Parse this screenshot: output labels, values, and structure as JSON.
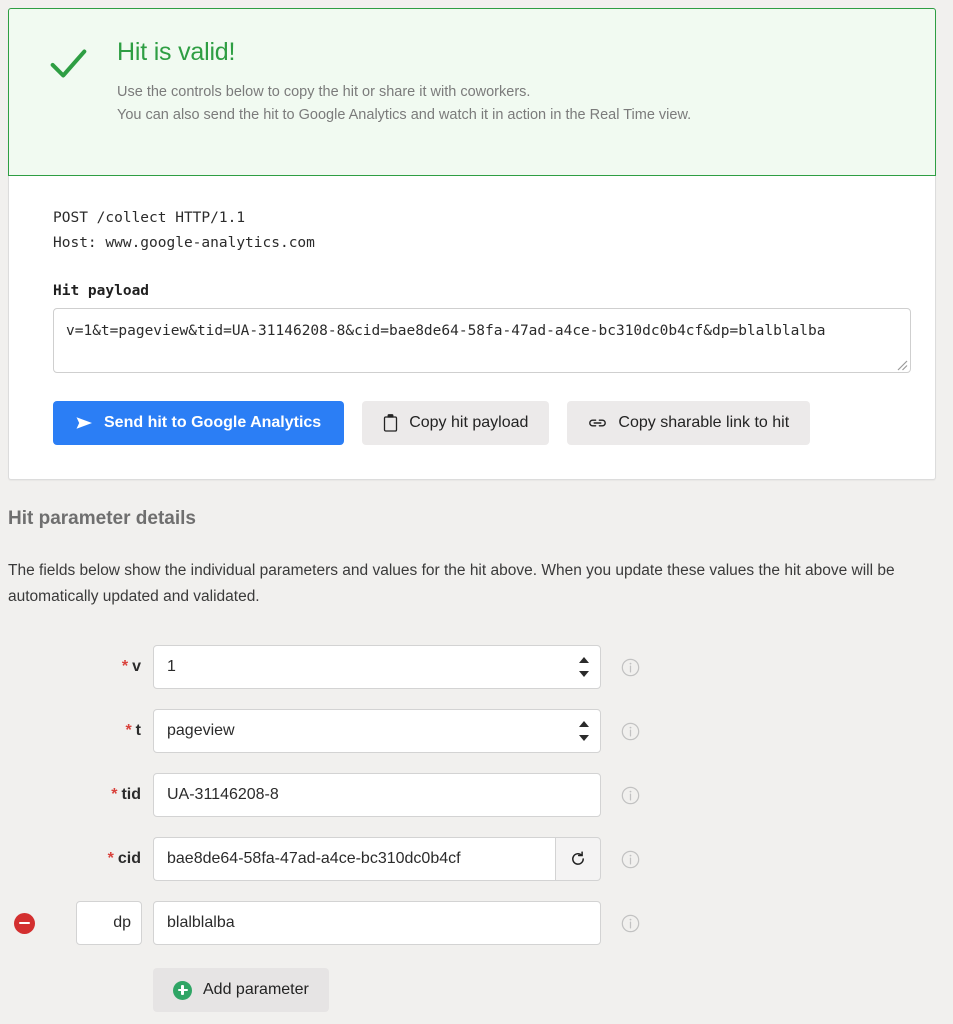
{
  "banner": {
    "icon": "check-icon",
    "title": "Hit is valid!",
    "line1": "Use the controls below to copy the hit or share it with coworkers.",
    "line2": "You can also send the hit to Google Analytics and watch it in action in the Real Time view.",
    "accent_color": "#2e9e43",
    "background_color": "#f1faf1"
  },
  "request": {
    "line1": "POST /collect HTTP/1.1",
    "line2": "Host: www.google-analytics.com",
    "payload_label": "Hit payload",
    "payload_value": "v=1&t=pageview&tid=UA-31146208-8&cid=bae8de64-58fa-47ad-a4ce-bc310dc0b4cf&dp=blalblalba"
  },
  "actions": {
    "send": {
      "label": "Send hit to Google Analytics",
      "icon": "send-icon",
      "color": "#2b7ef5"
    },
    "copy_payload": {
      "label": "Copy hit payload",
      "icon": "clipboard-icon"
    },
    "copy_link": {
      "label": "Copy sharable link to hit",
      "icon": "link-icon"
    }
  },
  "details": {
    "title": "Hit parameter details",
    "description": "The fields below show the individual parameters and values for the hit above. When you update these values the hit above will be automatically updated and validated."
  },
  "form": {
    "required_marker": "*",
    "rows": [
      {
        "name": "v",
        "label": "v",
        "required": true,
        "control": "select",
        "value": "1",
        "info": "info-icon"
      },
      {
        "name": "t",
        "label": "t",
        "required": true,
        "control": "select",
        "value": "pageview",
        "info": "info-icon"
      },
      {
        "name": "tid",
        "label": "tid",
        "required": true,
        "control": "text",
        "value": "UA-31146208-8",
        "info": "info-icon"
      },
      {
        "name": "cid",
        "label": "cid",
        "required": true,
        "control": "text",
        "value": "bae8de64-58fa-47ad-a4ce-bc310dc0b4cf",
        "refresh": "refresh-icon",
        "info": "info-icon"
      },
      {
        "name": "dp",
        "label": "dp",
        "required": false,
        "control": "text",
        "key_value": "dp",
        "value": "blalblalba",
        "removable": true,
        "info": "info-icon"
      }
    ],
    "add_button": {
      "label": "Add parameter",
      "icon": "plus-circle-icon",
      "color": "#2fa565"
    },
    "remove_color": "#d32f2f"
  }
}
